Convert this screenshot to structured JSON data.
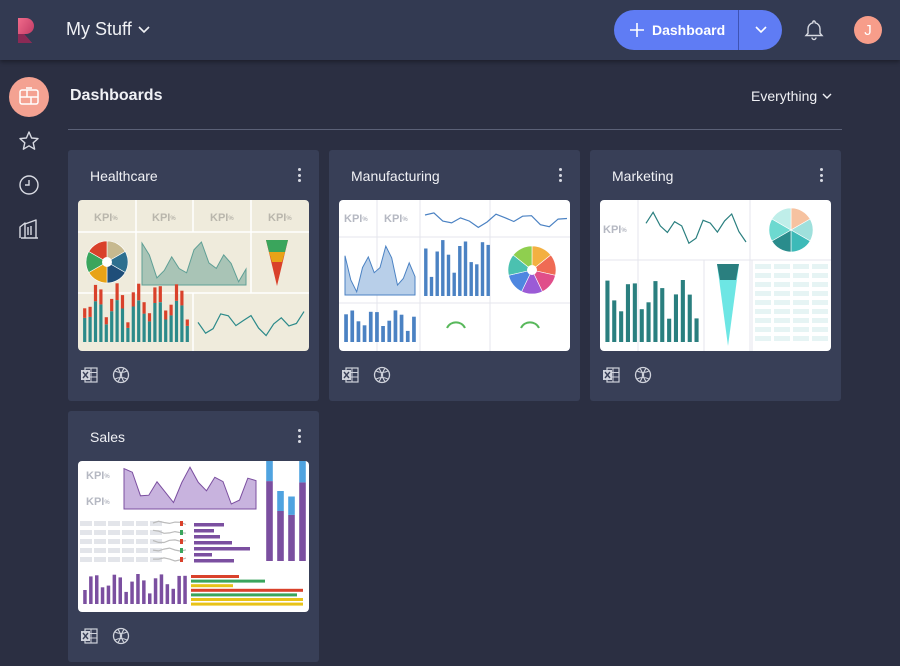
{
  "app": {
    "title": "My Stuff"
  },
  "header": {
    "new_dashboard_label": "Dashboard",
    "user_initial": "J",
    "colors": {
      "accent": "#5f7cf4",
      "avatar": "#f79d8a",
      "topbar": "#333a52"
    }
  },
  "sidebar": {
    "items": [
      {
        "name": "dashboards",
        "icon": "dashboard-icon",
        "active": true
      },
      {
        "name": "favorites",
        "icon": "star-icon",
        "active": false
      },
      {
        "name": "recent",
        "icon": "clock-icon",
        "active": false
      },
      {
        "name": "library",
        "icon": "library-icon",
        "active": false
      }
    ]
  },
  "main": {
    "title": "Dashboards",
    "filter_label": "Everything",
    "cards": [
      {
        "title": "Healthcare",
        "thumbnail": "healthcare",
        "sources": [
          "excel-icon",
          "web-icon"
        ]
      },
      {
        "title": "Manufacturing",
        "thumbnail": "manufacturing",
        "sources": [
          "excel-icon",
          "web-icon"
        ]
      },
      {
        "title": "Marketing",
        "thumbnail": "marketing",
        "sources": [
          "excel-icon",
          "web-icon"
        ]
      },
      {
        "title": "Sales",
        "thumbnail": "sales",
        "sources": [
          "excel-icon",
          "web-icon"
        ]
      }
    ],
    "kpi_label": "KPI",
    "kpi_suffix": "%"
  }
}
